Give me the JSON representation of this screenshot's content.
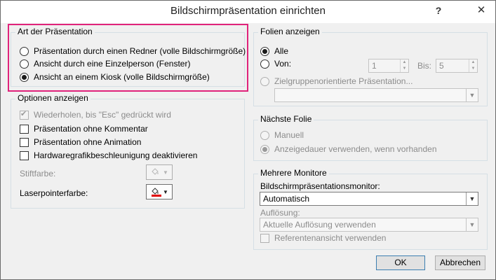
{
  "window": {
    "title": "Bildschirmpräsentation einrichten",
    "help_label": "?",
    "close_label": "✕"
  },
  "art": {
    "title": "Art der Präsentation",
    "options": [
      {
        "label": "Präsentation durch einen Redner (volle Bildschirmgröße)",
        "checked": false
      },
      {
        "label": "Ansicht durch eine Einzelperson (Fenster)",
        "checked": false
      },
      {
        "label": "Ansicht an einem Kiosk (volle Bildschirmgröße)",
        "checked": true
      }
    ],
    "highlight_color": "#e0237b"
  },
  "optionen": {
    "title": "Optionen anzeigen",
    "checks": [
      {
        "label": "Wiederholen, bis \"Esc\" gedrückt wird",
        "checked": true,
        "disabled": true
      },
      {
        "label": "Präsentation ohne Kommentar",
        "checked": false,
        "disabled": false
      },
      {
        "label": "Präsentation ohne Animation",
        "checked": false,
        "disabled": false
      },
      {
        "label": "Hardwaregrafikbeschleunigung deaktivieren",
        "checked": false,
        "disabled": false
      }
    ],
    "stiftfarbe_label": "Stiftfarbe:",
    "laser_label": "Laserpointerfarbe:",
    "laser_color": "#e00000"
  },
  "folien": {
    "title": "Folien anzeigen",
    "alle_label": "Alle",
    "von_label": "Von:",
    "von_value": "1",
    "bis_label": "Bis:",
    "bis_value": "5",
    "ziel_label": "Zielgruppenorientierte Präsentation...",
    "ziel_value": ""
  },
  "naechste": {
    "title": "Nächste Folie",
    "manuell_label": "Manuell",
    "anzeige_label": "Anzeigedauer verwenden, wenn vorhanden"
  },
  "monitore": {
    "title": "Mehrere Monitore",
    "monitor_label": "Bildschirmpräsentationsmonitor:",
    "monitor_value": "Automatisch",
    "aufloesung_label": "Auflösung:",
    "aufloesung_value": "Aktuelle Auflösung verwenden",
    "referenten_label": "Referentenansicht verwenden"
  },
  "buttons": {
    "ok": "OK",
    "cancel": "Abbrechen"
  }
}
